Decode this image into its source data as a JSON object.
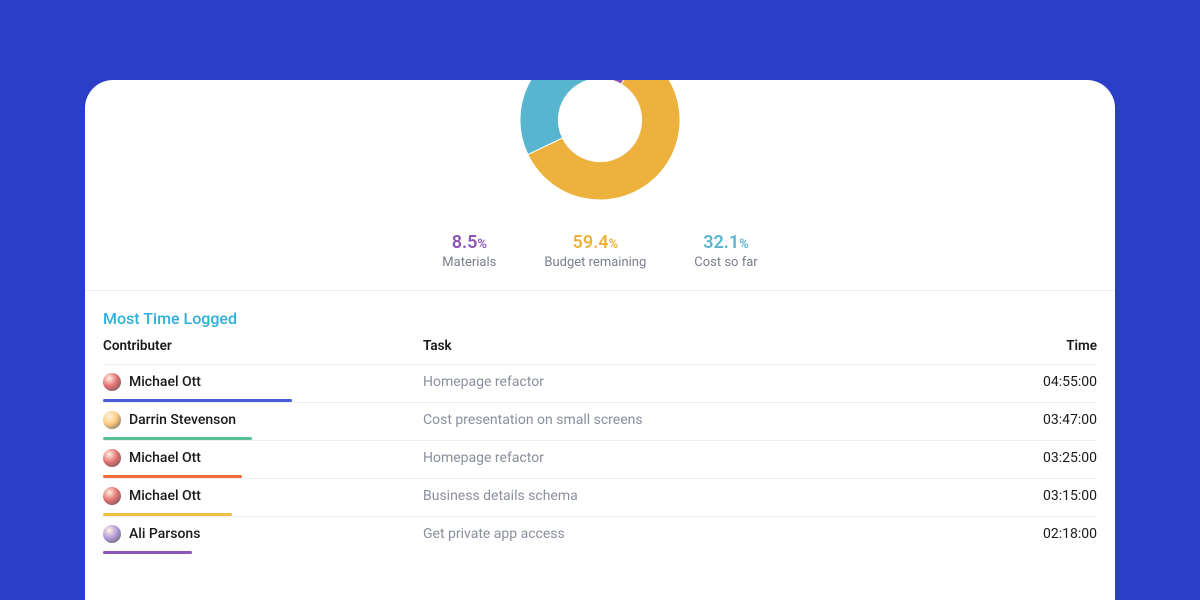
{
  "chart_data": {
    "type": "pie",
    "series": [
      {
        "name": "Materials",
        "value": 8.5,
        "color": "#8e55b9"
      },
      {
        "name": "Budget remaining",
        "value": 59.4,
        "color": "#edb23d"
      },
      {
        "name": "Cost so far",
        "value": 32.1,
        "color": "#58b5d0"
      }
    ],
    "donut_inner_ratio": 0.52
  },
  "legend": [
    {
      "value": "8.5",
      "pct": "%",
      "label": "Materials",
      "color": "#8e55b9"
    },
    {
      "value": "59.4",
      "pct": "%",
      "label": "Budget remaining",
      "color": "#edb23d"
    },
    {
      "value": "32.1",
      "pct": "%",
      "label": "Cost so far",
      "color": "#58b5d0"
    }
  ],
  "section": {
    "title": "Most Time Logged",
    "headers": {
      "contributer": "Contributer",
      "task": "Task",
      "time": "Time"
    },
    "rows": [
      {
        "name": "Michael Ott",
        "task": "Homepage refactor",
        "time": "04:55:00",
        "bar_color": "#4b5bd8",
        "bar_pct": 19,
        "avatar_color": "#e57373"
      },
      {
        "name": "Darrin Stevenson",
        "task": "Cost presentation on small screens",
        "time": "03:47:00",
        "bar_color": "#58c094",
        "bar_pct": 15,
        "avatar_color": "#ffcc80"
      },
      {
        "name": "Michael Ott",
        "task": "Homepage refactor",
        "time": "03:25:00",
        "bar_color": "#f06a3b",
        "bar_pct": 14,
        "avatar_color": "#e57373"
      },
      {
        "name": "Michael Ott",
        "task": "Business details schema",
        "time": "03:15:00",
        "bar_color": "#eec040",
        "bar_pct": 13,
        "avatar_color": "#e57373"
      },
      {
        "name": "Ali Parsons",
        "task": "Get private app access",
        "time": "02:18:00",
        "bar_color": "#8e55b9",
        "bar_pct": 9,
        "avatar_color": "#b39ddb"
      }
    ]
  }
}
